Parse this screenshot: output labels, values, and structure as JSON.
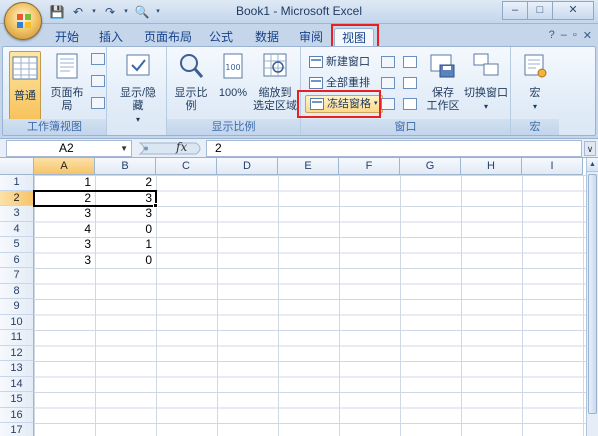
{
  "title": "Book1 - Microsoft Excel",
  "quick_access": [
    "save-icon",
    "undo-icon",
    "redo-icon",
    "print-preview-icon"
  ],
  "window_controls": [
    "–",
    "□",
    "✕"
  ],
  "tabs": [
    "开始",
    "插入",
    "页面布局",
    "公式",
    "数据",
    "审阅",
    "视图"
  ],
  "active_tab": "视图",
  "ribbon_right_controls": [
    "?",
    "–",
    "▫",
    "✕"
  ],
  "groups": {
    "workbook_views": {
      "label": "工作簿视图",
      "normal": "普通",
      "page_layout": "页面布局"
    },
    "show_hide": {
      "label": "显示/隐藏"
    },
    "zoom": {
      "label": "显示比例",
      "zoom": "显示比例",
      "hundred": "100%",
      "zoom_to_selection": [
        "缩放到",
        "选定区域"
      ]
    },
    "window": {
      "label": "窗口",
      "new_window": "新建窗口",
      "arrange_all": "全部重排",
      "freeze_panes": "冻结窗格",
      "save_workspace": [
        "保存",
        "工作区"
      ],
      "switch_windows": "切换窗口"
    },
    "macros": {
      "label": "宏",
      "macros": "宏"
    }
  },
  "formula_bar": {
    "name_box": "A2",
    "fx": "fx",
    "formula": "2"
  },
  "columns": [
    "A",
    "B",
    "C",
    "D",
    "E",
    "F",
    "G",
    "H",
    "I"
  ],
  "rows": [
    "1",
    "2",
    "3",
    "4",
    "5",
    "6",
    "7",
    "8",
    "9",
    "10",
    "11",
    "12",
    "13",
    "14",
    "15",
    "16",
    "17"
  ],
  "cells": [
    [
      "1",
      "2"
    ],
    [
      "2",
      "3"
    ],
    [
      "3",
      "3"
    ],
    [
      "4",
      "0"
    ],
    [
      "3",
      "1"
    ],
    [
      "3",
      "0"
    ]
  ],
  "selected_cell": "A2",
  "colors": {
    "highlight": "#e8201f",
    "selected_header": "#f6c468"
  }
}
